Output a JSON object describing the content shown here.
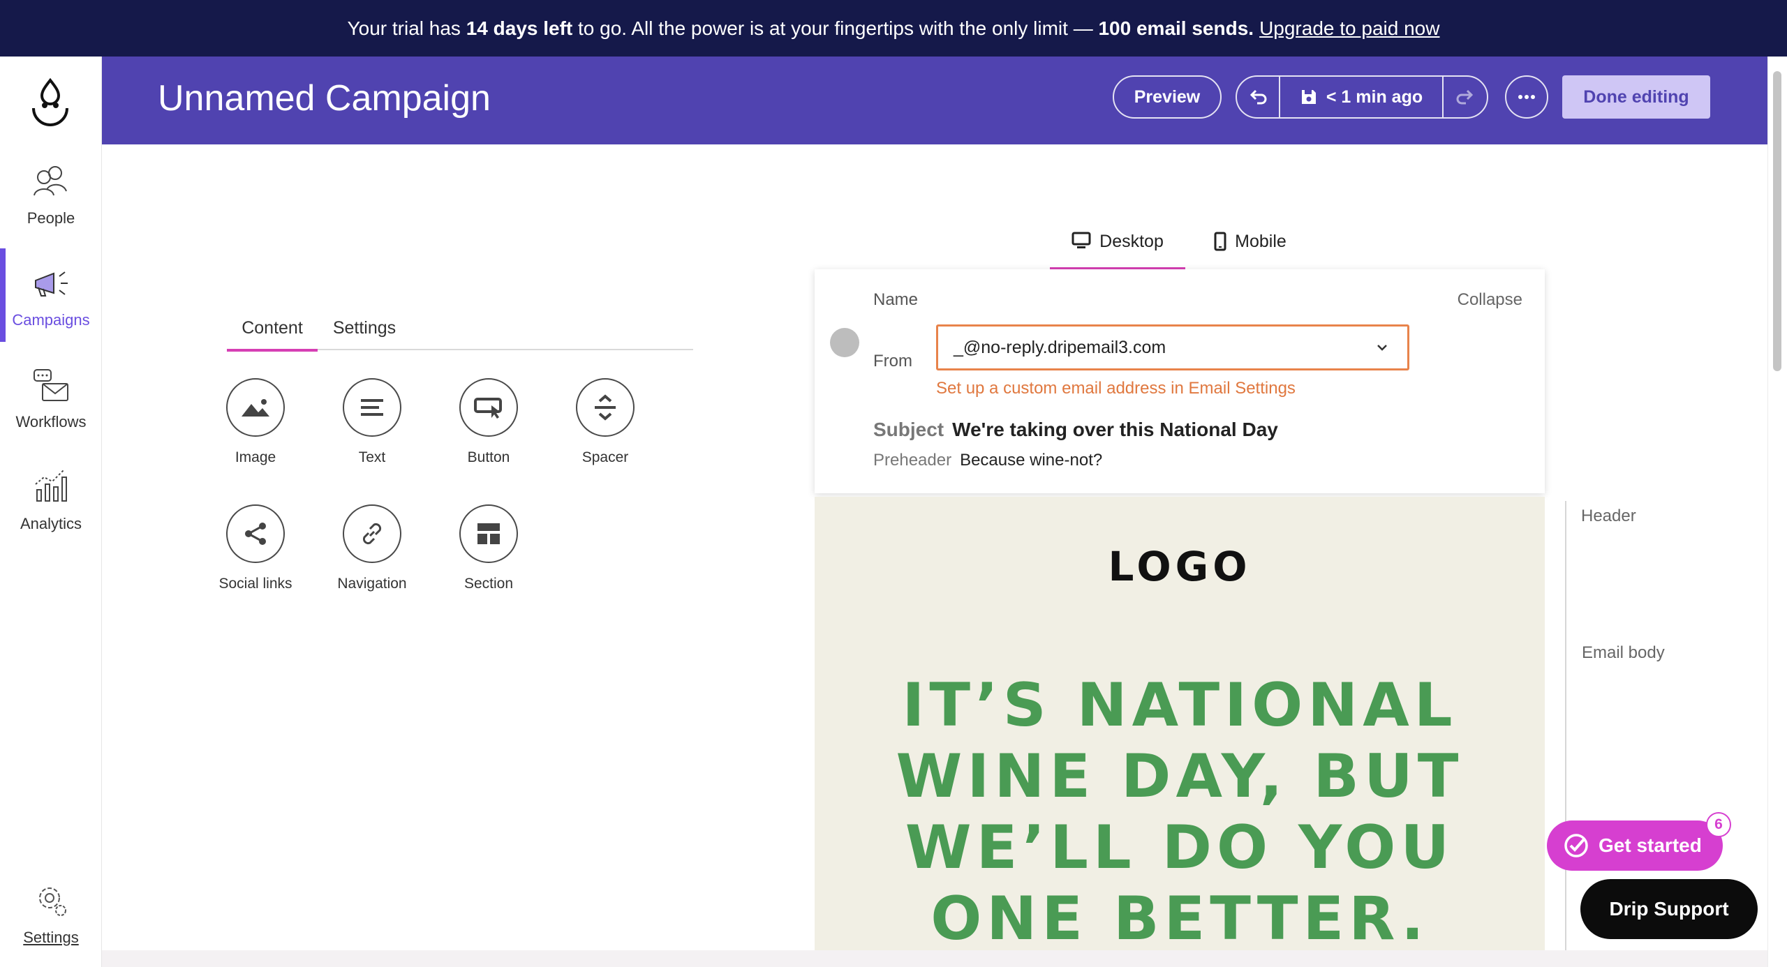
{
  "banner": {
    "part1": "Your trial has",
    "days": "14 days left",
    "part2": "to go. All the power is at your fingertips with the only limit —",
    "limit": "100 email sends.",
    "link": "Upgrade to paid now"
  },
  "nav": {
    "items": [
      {
        "label": "People",
        "icon": "people-icon"
      },
      {
        "label": "Campaigns",
        "icon": "megaphone-icon",
        "active": true
      },
      {
        "label": "Workflows",
        "icon": "workflows-icon"
      },
      {
        "label": "Analytics",
        "icon": "analytics-icon"
      }
    ],
    "settings": "Settings"
  },
  "header": {
    "title": "Unnamed Campaign",
    "preview": "Preview",
    "saved": "< 1 min ago",
    "done": "Done editing"
  },
  "panel": {
    "tabs": [
      "Content",
      "Settings"
    ],
    "blocks": [
      {
        "label": "Image",
        "icon": "image-icon"
      },
      {
        "label": "Text",
        "icon": "text-icon"
      },
      {
        "label": "Button",
        "icon": "button-icon"
      },
      {
        "label": "Spacer",
        "icon": "spacer-icon"
      },
      {
        "label": "Social links",
        "icon": "share-icon"
      },
      {
        "label": "Navigation",
        "icon": "link-icon"
      },
      {
        "label": "Section",
        "icon": "section-icon"
      }
    ]
  },
  "devices": {
    "desktop": "Desktop",
    "mobile": "Mobile"
  },
  "card": {
    "name_label": "Name",
    "collapse": "Collapse",
    "from_label": "From",
    "from_value": "_@no-reply.dripemail3.com",
    "custom_link": "Set up a custom email address in Email Settings",
    "subject_label": "Subject",
    "subject_value": "We're taking over this National Day",
    "preheader_label": "Preheader",
    "preheader_value": "Because wine-not?"
  },
  "email": {
    "logo": "LOGO",
    "headline": [
      "IT’S NATIONAL",
      "WINE DAY, BUT",
      "WE’LL DO YOU",
      "ONE BETTER."
    ]
  },
  "outline": {
    "header": "Header",
    "body": "Email body"
  },
  "floating": {
    "get_started": "Get started",
    "badge": "6",
    "support": "Drip Support"
  },
  "colors": {
    "banner": "#15194a",
    "header": "#5043b0",
    "accent": "#d63fb4",
    "headline": "#4a9b54",
    "email_bg": "#f1efe4"
  }
}
